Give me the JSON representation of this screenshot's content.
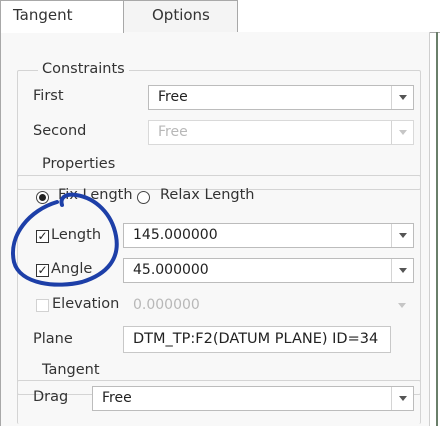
{
  "tabs": [
    {
      "label": "Tangent",
      "active": true
    },
    {
      "label": "Options",
      "active": false
    }
  ],
  "constraints": {
    "title": "Constraints",
    "first": {
      "label": "First",
      "value": "Free"
    },
    "second": {
      "label": "Second",
      "value": "Free",
      "disabled": true
    }
  },
  "properties": {
    "title": "Properties",
    "fix_length": {
      "label": "Fix Length",
      "selected": true
    },
    "relax_length": {
      "label": "Relax Length",
      "selected": false
    },
    "length": {
      "label": "Length",
      "checked": true,
      "value": "145.000000"
    },
    "angle": {
      "label": "Angle",
      "checked": true,
      "value": "45.000000"
    },
    "elevation": {
      "label": "Elevation",
      "checked": false,
      "value": "0.000000",
      "disabled": true
    },
    "plane": {
      "label": "Plane",
      "value": "DTM_TP:F2(DATUM PLANE) ID=34"
    }
  },
  "tangent": {
    "title": "Tangent",
    "drag": {
      "label": "Drag",
      "value": "Free"
    }
  },
  "colors": {
    "annotation_stroke": "#1d3fa8",
    "side_bar": "#6a7f6a"
  },
  "icons": {
    "dropdown": "chevron-down-icon",
    "check": "check-icon"
  }
}
